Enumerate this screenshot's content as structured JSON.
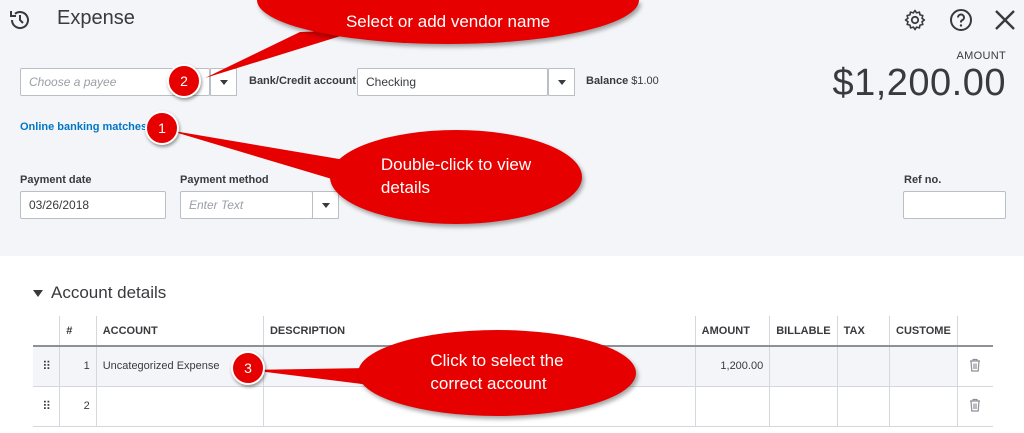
{
  "header": {
    "title": "Expense",
    "icons": [
      "recurring-history-icon",
      "gear-icon",
      "help-icon",
      "close-icon"
    ]
  },
  "payee": {
    "placeholder": "Choose a payee"
  },
  "bank": {
    "label": "Bank/Credit account",
    "value": "Checking",
    "balance_label": "Balance",
    "balance_value": "$1.00"
  },
  "online_banking_link": "Online banking matches",
  "amount": {
    "label": "AMOUNT",
    "value": "$1,200.00"
  },
  "payment_date": {
    "label": "Payment date",
    "value": "03/26/2018"
  },
  "payment_method": {
    "label": "Payment method",
    "placeholder": "Enter Text"
  },
  "ref_no": {
    "label": "Ref no.",
    "value": ""
  },
  "account_details": {
    "title": "Account details",
    "columns": [
      "#",
      "ACCOUNT",
      "DESCRIPTION",
      "AMOUNT",
      "BILLABLE",
      "TAX",
      "CUSTOME"
    ],
    "rows": [
      {
        "num": "1",
        "account": "Uncategorized Expense",
        "description": "",
        "amount": "1,200.00"
      },
      {
        "num": "2",
        "account": "",
        "description": "",
        "amount": ""
      }
    ]
  },
  "annotations": {
    "vendor_callout": "Select or add vendor name",
    "details_callout_1": "Double-click to view",
    "details_callout_2": "details",
    "account_callout_1": "Click to select the",
    "account_callout_2": "correct account",
    "badge_1": "1",
    "badge_2": "2",
    "badge_3": "3"
  },
  "colors": {
    "accent_red": "#e60000",
    "link_blue": "#0077c5",
    "header_bg": "#f4f5f8"
  }
}
